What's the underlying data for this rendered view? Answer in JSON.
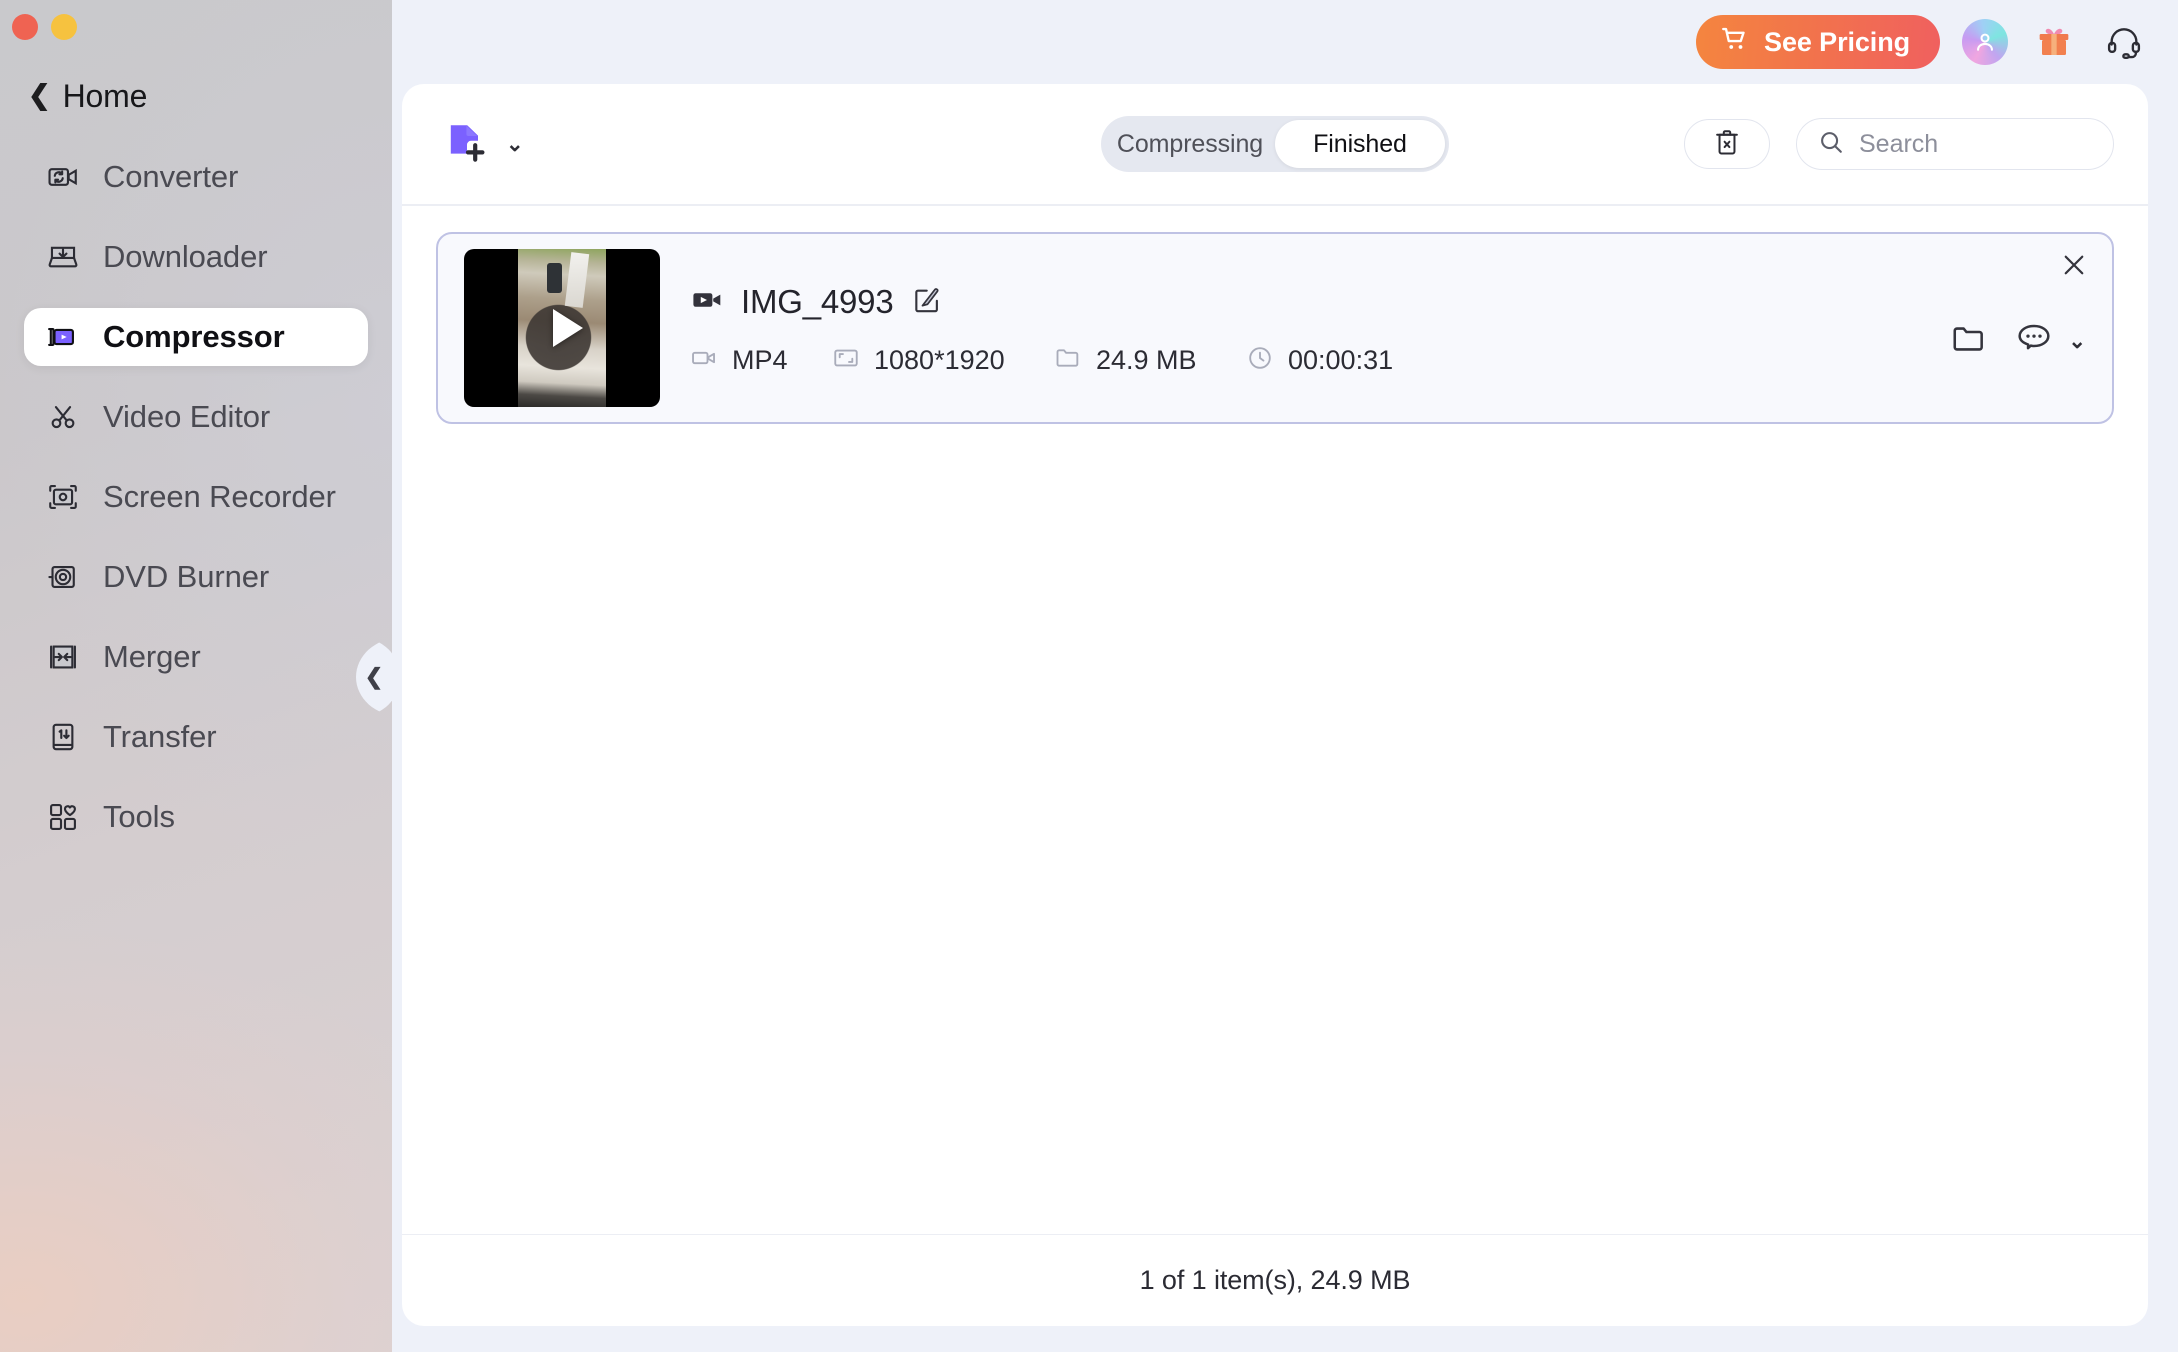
{
  "window": {
    "traffic_lights": [
      "close",
      "minimize"
    ]
  },
  "sidebar": {
    "back_label": "Home",
    "back_icon": "chevron-left-icon",
    "collapse_icon": "chevron-left-icon",
    "items": [
      {
        "label": "Converter",
        "icon": "video-convert-icon",
        "active": false
      },
      {
        "label": "Downloader",
        "icon": "download-tray-icon",
        "active": false
      },
      {
        "label": "Compressor",
        "icon": "video-compress-icon",
        "active": true
      },
      {
        "label": "Video Editor",
        "icon": "scissors-icon",
        "active": false
      },
      {
        "label": "Screen Recorder",
        "icon": "screen-capture-icon",
        "active": false
      },
      {
        "label": "DVD Burner",
        "icon": "disc-icon",
        "active": false
      },
      {
        "label": "Merger",
        "icon": "merge-arrows-icon",
        "active": false
      },
      {
        "label": "Transfer",
        "icon": "phone-transfer-icon",
        "active": false
      },
      {
        "label": "Tools",
        "icon": "toolbox-grid-icon",
        "active": false
      }
    ]
  },
  "topbar": {
    "pricing_label": "See Pricing",
    "pricing_icon": "shopping-cart-icon",
    "pricing_color": "#f2744b",
    "avatar_icon": "user-avatar-icon",
    "gift_icon": "gift-icon",
    "support_icon": "headset-icon"
  },
  "toolbar": {
    "add_file_icon": "add-file-icon",
    "add_file_caret": "⌄",
    "tabs": [
      {
        "label": "Compressing",
        "active": false
      },
      {
        "label": "Finished",
        "active": true
      }
    ],
    "clear_icon": "trash-x-icon",
    "search": {
      "icon": "search-icon",
      "value": "",
      "placeholder": "Search"
    }
  },
  "file_list": {
    "items": [
      {
        "name": "IMG_4993",
        "type_icon": "video-camera-icon",
        "rename_icon": "edit-pencil-icon",
        "format": "MP4",
        "format_icon": "video-format-icon",
        "resolution": "1080*1920",
        "resolution_icon": "resolution-frame-icon",
        "size": "24.9 MB",
        "size_icon": "folder-icon",
        "duration": "00:00:31",
        "duration_icon": "clock-icon",
        "open_folder_icon": "folder-open-icon",
        "more_icon": "more-options-icon",
        "more_caret": "⌄",
        "close_icon": "close-x-icon",
        "selected": true
      }
    ]
  },
  "footer": {
    "summary": "1 of 1 item(s), 24.9 MB"
  }
}
